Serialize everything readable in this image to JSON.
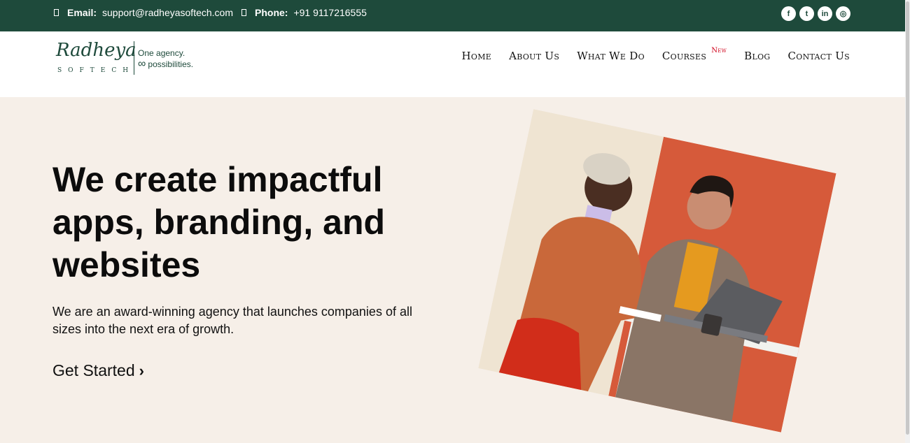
{
  "topbar": {
    "email_label": "Email:",
    "email_value": "support@radheyasoftech.com",
    "phone_label": "Phone:",
    "phone_value": "+91 9117216555",
    "socials": [
      {
        "icon": "facebook-icon",
        "glyph": "f"
      },
      {
        "icon": "twitter-icon",
        "glyph": "t"
      },
      {
        "icon": "linkedin-icon",
        "glyph": "in"
      },
      {
        "icon": "instagram-icon",
        "glyph": "◎"
      }
    ]
  },
  "logo": {
    "word": "Radheya",
    "sub": "SOFTECH",
    "tagline_1": "One agency.",
    "tagline_2": "possibilities."
  },
  "nav": {
    "items": [
      "Home",
      "About Us",
      "What We Do",
      "Courses",
      "Blog",
      "Contact Us"
    ],
    "courses_badge": "New"
  },
  "hero": {
    "title": "We create impactful apps, branding, and websites",
    "subtitle": "We are an award-winning agency that launches companies of all sizes into the next era of growth.",
    "cta_label": "Get Started"
  },
  "colors": {
    "brand_green": "#1e4a3b",
    "hero_bg": "#f6efe8",
    "badge_red": "#d0021b"
  }
}
